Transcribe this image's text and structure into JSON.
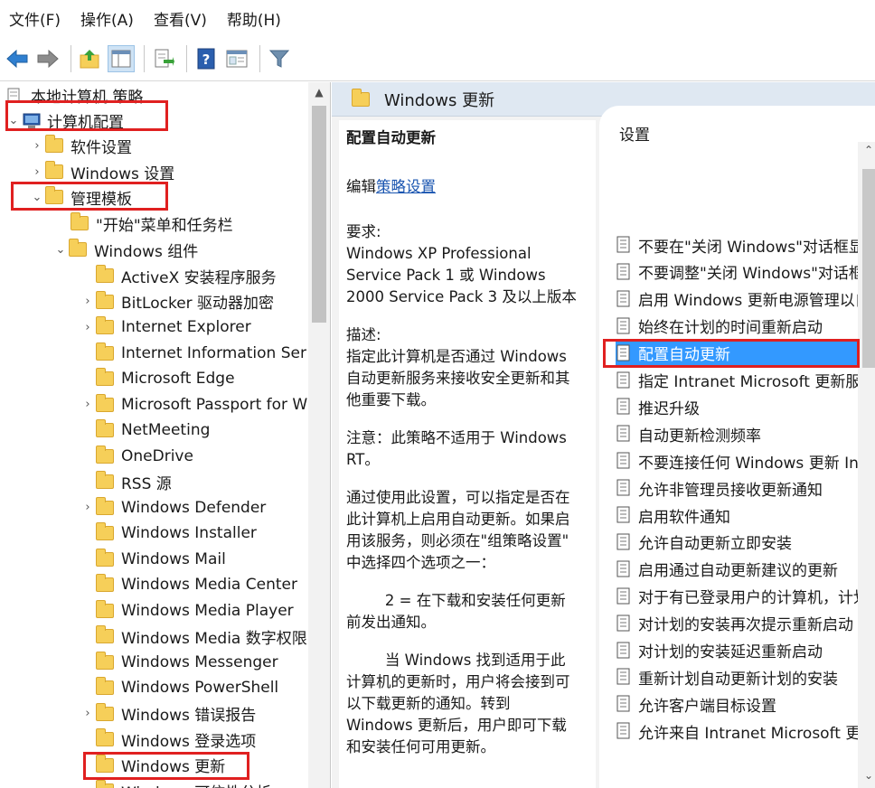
{
  "menubar": {
    "items": [
      "文件(F)",
      "操作(A)",
      "查看(V)",
      "帮助(H)"
    ]
  },
  "toolbar": {
    "buttons": [
      "back-icon",
      "forward-icon",
      "up-folder-icon",
      "show-hide-tree-icon",
      "export-list-icon",
      "help-icon",
      "properties-view-icon",
      "filter-icon"
    ]
  },
  "tree": {
    "root": "本地计算机 策略",
    "computer_config": "计算机配置",
    "software_settings": "软件设置",
    "windows_settings": "Windows 设置",
    "admin_templates": "管理模板",
    "start_menu_taskbar": "\"开始\"菜单和任务栏",
    "windows_components": "Windows 组件",
    "items": [
      {
        "label": "ActiveX 安装程序服务",
        "expandable": false
      },
      {
        "label": "BitLocker 驱动器加密",
        "expandable": true
      },
      {
        "label": "Internet Explorer",
        "expandable": true
      },
      {
        "label": "Internet Information Ser",
        "expandable": false
      },
      {
        "label": "Microsoft Edge",
        "expandable": false
      },
      {
        "label": "Microsoft Passport for W",
        "expandable": true
      },
      {
        "label": "NetMeeting",
        "expandable": false
      },
      {
        "label": "OneDrive",
        "expandable": false
      },
      {
        "label": "RSS 源",
        "expandable": false
      },
      {
        "label": "Windows Defender",
        "expandable": true
      },
      {
        "label": "Windows Installer",
        "expandable": false
      },
      {
        "label": "Windows Mail",
        "expandable": false
      },
      {
        "label": "Windows Media Center",
        "expandable": false
      },
      {
        "label": "Windows Media Player",
        "expandable": false
      },
      {
        "label": "Windows Media 数字权限",
        "expandable": false
      },
      {
        "label": "Windows Messenger",
        "expandable": false
      },
      {
        "label": "Windows PowerShell",
        "expandable": false
      },
      {
        "label": "Windows 错误报告",
        "expandable": true
      },
      {
        "label": "Windows 登录选项",
        "expandable": false
      },
      {
        "label": "Windows 更新",
        "expandable": false
      },
      {
        "label": "Windows 可信性分析",
        "expandable": false
      }
    ]
  },
  "header": {
    "title": "Windows 更新"
  },
  "description": {
    "title": "配置自动更新",
    "edit_prefix": "编辑",
    "edit_link": "策略设置",
    "requirements": [
      "要求:",
      "Windows XP Professional",
      "Service Pack 1 或 Windows",
      "2000 Service Pack 3 及以上版本"
    ],
    "desc": [
      "描述:",
      "指定此计算机是否通过 Windows",
      "自动更新服务来接收安全更新和其",
      "他重要下载。"
    ],
    "note": [
      "注意：此策略不适用于 Windows",
      "RT。"
    ],
    "usage": [
      "通过使用此设置，可以指定是否在",
      "此计算机上启用自动更新。如果启",
      "用该服务，则必须在\"组策略设置\"",
      "中选择四个选项之一："
    ],
    "option2": [
      "2 = 在下载和安装任何更新",
      "前发出通知。"
    ],
    "when": [
      "当 Windows 找到适用于此",
      "计算机的更新时，用户将会接到可",
      "以下载更新的通知。转到",
      "Windows 更新后，用户即可下载",
      "和安装任何可用更新。"
    ]
  },
  "settings": {
    "header": "设置",
    "selected_index": 4,
    "items": [
      "不要在\"关闭 Windows\"对话框显示",
      "不要调整\"关闭 Windows\"对话框里",
      "启用 Windows 更新电源管理以自动",
      "始终在计划的时间重新启动",
      "配置自动更新",
      "指定 Intranet Microsoft 更新服务",
      "推迟升级",
      "自动更新检测频率",
      "不要连接任何 Windows 更新 Inte",
      "允许非管理员接收更新通知",
      "启用软件通知",
      "允许自动更新立即安装",
      "启用通过自动更新建议的更新",
      "对于有已登录用户的计算机，计划的",
      "对计划的安装再次提示重新启动",
      "对计划的安装延迟重新启动",
      "重新计划自动更新计划的安装",
      "允许客户端目标设置",
      "允许来自 Intranet Microsoft 更新"
    ]
  },
  "colors": {
    "selection": "#3399ff",
    "highlight_box": "#e02020",
    "folder": "#f6cf59",
    "header_bg": "#dfe8f2"
  }
}
